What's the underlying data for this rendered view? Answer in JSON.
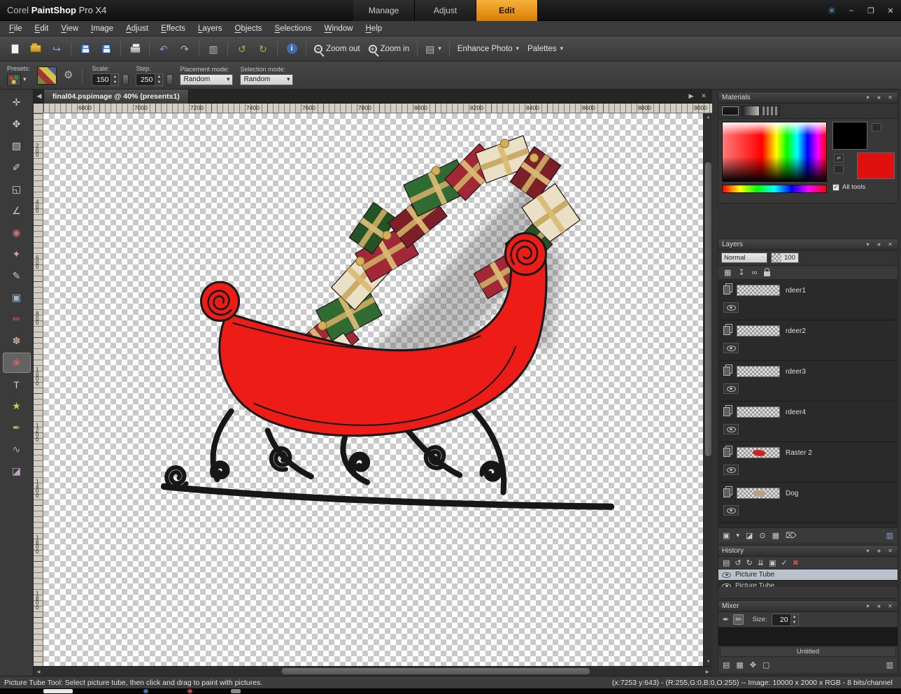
{
  "titlebar": {
    "app_prefix": "Corel ",
    "app_bold": "PaintShop",
    "app_suffix": " Pro X4",
    "tabs": [
      {
        "label": "Manage",
        "active": false
      },
      {
        "label": "Adjust",
        "active": false
      },
      {
        "label": "Edit",
        "active": true
      }
    ]
  },
  "menubar": {
    "items": [
      "File",
      "Edit",
      "View",
      "Image",
      "Adjust",
      "Effects",
      "Layers",
      "Objects",
      "Selections",
      "Window",
      "Help"
    ]
  },
  "toolbar": {
    "zoom_out": "Zoom out",
    "zoom_in": "Zoom in",
    "enhance_photo": "Enhance Photo",
    "palettes": "Palettes"
  },
  "options": {
    "presets_label": "Presets:",
    "scale_label": "Scale:",
    "scale_value": "150",
    "step_label": "Step:",
    "step_value": "250",
    "placement_label": "Placement mode:",
    "placement_value": "Random",
    "selection_label": "Selection mode:",
    "selection_value": "Random"
  },
  "document": {
    "tab_label": "final04.pspimage @ 40% (presents1)"
  },
  "ruler": {
    "h": [
      "6800",
      "7000",
      "7200",
      "7400",
      "7600",
      "7800",
      "8000",
      "8200",
      "8400",
      "8600",
      "8800",
      "9000"
    ],
    "v": [
      "200",
      "400",
      "600",
      "800",
      "1000",
      "1200",
      "1400",
      "1600",
      "1800"
    ]
  },
  "tools": [
    {
      "name": "pan",
      "glyph": "✛"
    },
    {
      "name": "move",
      "glyph": "✥"
    },
    {
      "name": "selection",
      "glyph": "▧"
    },
    {
      "name": "dropper",
      "glyph": "✐"
    },
    {
      "name": "crop",
      "glyph": "◱"
    },
    {
      "name": "straighten",
      "glyph": "∠"
    },
    {
      "name": "red-eye",
      "glyph": "◉",
      "color": "#cc7070"
    },
    {
      "name": "makeover",
      "glyph": "✦",
      "color": "#d9a0b0"
    },
    {
      "name": "clone-brush",
      "glyph": "✎",
      "color": "#c8c8c8"
    },
    {
      "name": "object-extractor",
      "glyph": "▣",
      "color": "#9ab8cc"
    },
    {
      "name": "paint-brush",
      "glyph": "✏",
      "color": "#d05050"
    },
    {
      "name": "airbrush",
      "glyph": "✽",
      "color": "#c8a890"
    },
    {
      "name": "picture-tube",
      "glyph": "❀",
      "color": "#d86060",
      "active": true
    },
    {
      "name": "text",
      "glyph": "T"
    },
    {
      "name": "preset-shapes",
      "glyph": "★",
      "color": "#cccc50"
    },
    {
      "name": "pen",
      "glyph": "✒",
      "color": "#c8b060"
    },
    {
      "name": "warp-brush",
      "glyph": "∿",
      "color": "#90c890"
    },
    {
      "name": "eraser",
      "glyph": "◪",
      "color": "#c0a0c0"
    }
  ],
  "panels": {
    "materials": {
      "title": "Materials",
      "all_tools_label": "All tools"
    },
    "layers": {
      "title": "Layers",
      "blend_mode": "Normal",
      "opacity": "100",
      "items": [
        {
          "name": "rdeer1"
        },
        {
          "name": "rdeer2"
        },
        {
          "name": "rdeer3"
        },
        {
          "name": "rdeer4"
        },
        {
          "name": "Raster 2",
          "mark": "#cc2222"
        },
        {
          "name": "Dog",
          "mark": "#b9a08a"
        }
      ]
    },
    "history": {
      "title": "History",
      "items": [
        {
          "label": "Picture Tube",
          "selected": true
        },
        {
          "label": "Picture Tube",
          "selected": false
        }
      ]
    },
    "mixer": {
      "title": "Mixer",
      "size_label": "Size:",
      "size_value": "20",
      "doc_name": "Untitled"
    }
  },
  "status": {
    "left": "Picture Tube Tool: Select picture tube, then click and drag to paint with pictures.",
    "right": "(x:7253 y:643) - (R:255,G:0,B:0,O:255) -- Image: 10000 x 2000 x RGB - 8 bits/channel"
  },
  "icons": {
    "minimize": "–",
    "restore": "❐",
    "close": "✕",
    "workspace": "✳",
    "undo": "↶",
    "redo": "↷",
    "twirl_left": "↺",
    "twirl_right": "↻",
    "info": "i",
    "gear": "⚙",
    "dropdown": "▾",
    "prev": "◀",
    "next": "▶",
    "up": "▲",
    "down": "▼",
    "left": "◀",
    "right": "▶",
    "check": "✓",
    "panel_menu": "▾",
    "panel_pin": "∗",
    "panel_close": "✕",
    "mag_minus": "−",
    "mag_plus": "+",
    "capture": "▥",
    "pages": "▤",
    "grid": "▦",
    "down_arrow": "↧",
    "link": "∞",
    "new_layer": "▣",
    "mask": "◪",
    "target": "⊙",
    "delete": "⌦",
    "blue_panel": "▥",
    "hist_undo": "↺",
    "hist_redo": "↻",
    "hist_down": "⇊",
    "hist_x": "✖",
    "knife": "✒",
    "brush": "✏",
    "move4": "✥",
    "blank": "▢"
  }
}
